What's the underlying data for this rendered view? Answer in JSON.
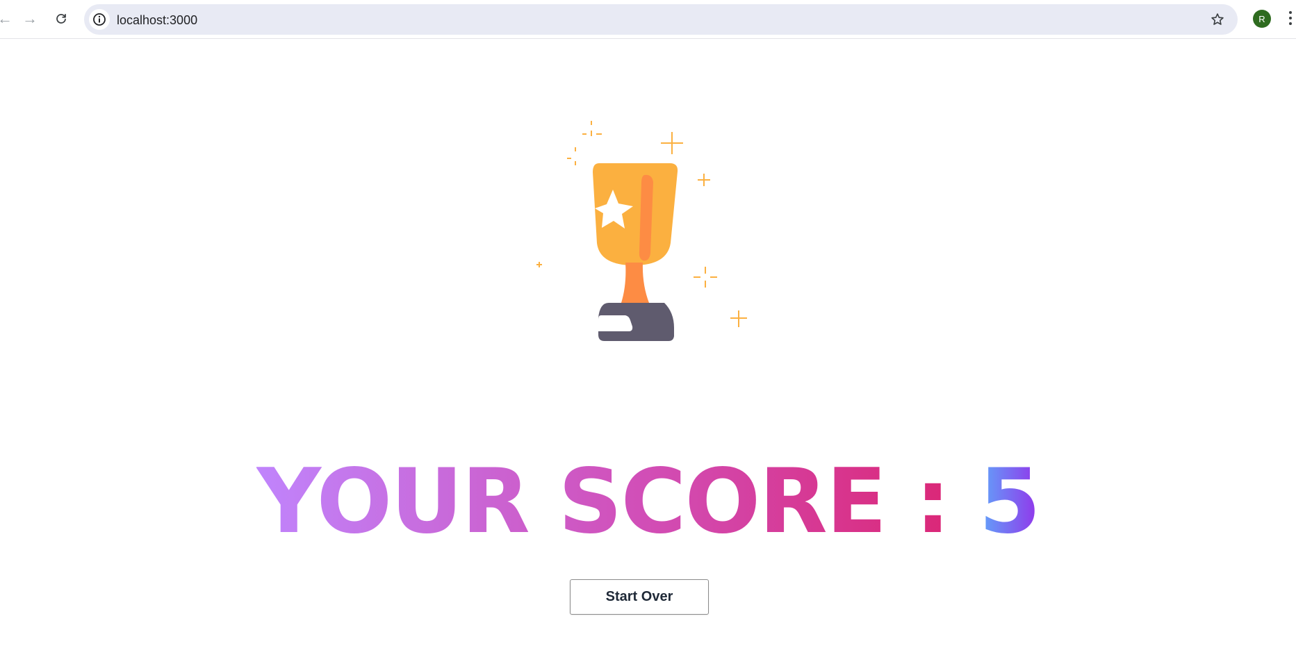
{
  "browser": {
    "url": "localhost:3000",
    "profile_initial": "R",
    "profile_color": "#2e6b1f",
    "icons": [
      "back-arrow-icon",
      "forward-arrow-icon",
      "reload-icon",
      "site-info-icon",
      "bookmark-star-icon",
      "kebab-menu-icon"
    ]
  },
  "result": {
    "score_label": "YOUR SCORE :",
    "score_value": "5",
    "illustration": "trophy-icon",
    "label_gradient": [
      "#c084fc",
      "#db2777"
    ],
    "value_gradient": [
      "#60a5fa",
      "#9333ea"
    ]
  },
  "actions": {
    "start_over_label": "Start Over"
  }
}
